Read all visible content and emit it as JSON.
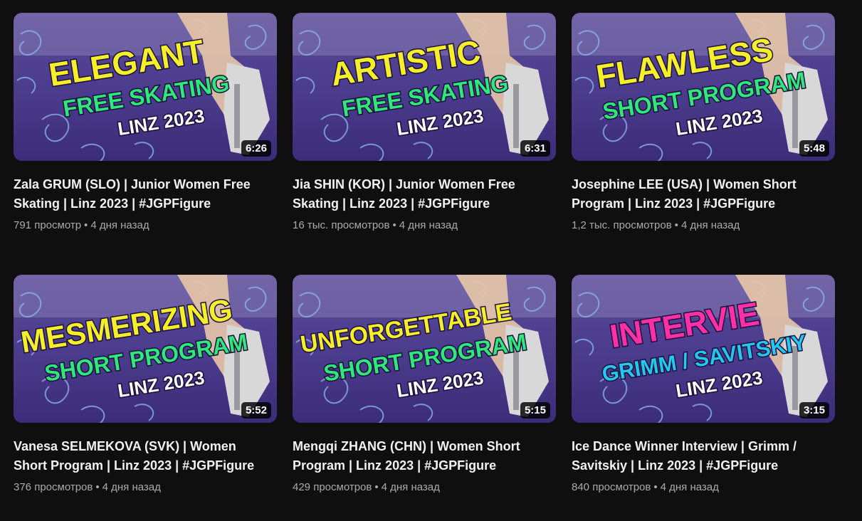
{
  "videos": [
    {
      "thumb": {
        "word": "ELEGANT",
        "line2": "FREE SKATING",
        "line3": "LINZ 2023",
        "word_color": "#f5ef2a",
        "line2_color": "#2ee87c"
      },
      "duration": "6:26",
      "title": "Zala GRUM (SLO) | Junior Women Free Skating | Linz 2023 | #JGPFigure",
      "views": "791 просмотр",
      "age": "4 дня назад"
    },
    {
      "thumb": {
        "word": "ARTISTIC",
        "line2": "FREE SKATING",
        "line3": "LINZ 2023",
        "word_color": "#f5ef2a",
        "line2_color": "#2ee87c"
      },
      "duration": "6:31",
      "title": "Jia SHIN (KOR) | Junior Women Free Skating | Linz 2023 | #JGPFigure",
      "views": "16 тыс. просмотров",
      "age": "4 дня назад"
    },
    {
      "thumb": {
        "word": "FLAWLESS",
        "line2": "SHORT PROGRAM",
        "line3": "LINZ 2023",
        "word_color": "#f5ef2a",
        "line2_color": "#2ee87c"
      },
      "duration": "5:48",
      "title": "Josephine LEE (USA) | Women Short Program | Linz 2023 | #JGPFigure",
      "views": "1,2 тыс. просмотров",
      "age": "4 дня назад"
    },
    {
      "thumb": {
        "word": "MESMERIZING",
        "line2": "SHORT PROGRAM",
        "line3": "LINZ 2023",
        "word_color": "#f5ef2a",
        "line2_color": "#2ee87c"
      },
      "duration": "5:52",
      "title": "Vanesa SELMEKOVA (SVK) | Women Short Program | Linz 2023 | #JGPFigure",
      "views": "376 просмотров",
      "age": "4 дня назад"
    },
    {
      "thumb": {
        "word": "UNFORGETTABLE",
        "line2": "SHORT PROGRAM",
        "line3": "LINZ 2023",
        "word_color": "#f5ef2a",
        "line2_color": "#2ee87c"
      },
      "duration": "5:15",
      "title": "Mengqi ZHANG (CHN) | Women Short Program | Linz 2023 | #JGPFigure",
      "views": "429 просмотров",
      "age": "4 дня назад"
    },
    {
      "thumb": {
        "word": "INTERVIE",
        "line2": "GRIMM / SAVITSKIY",
        "line3": "LINZ 2023",
        "word_color": "#ff2fa8",
        "line2_color": "#22c8f0"
      },
      "duration": "3:15",
      "title": "Ice Dance Winner Interview | Grimm / Savitskiy | Linz 2023 | #JGPFigure",
      "views": "840 просмотров",
      "age": "4 дня назад"
    }
  ],
  "meta_separator": "•"
}
